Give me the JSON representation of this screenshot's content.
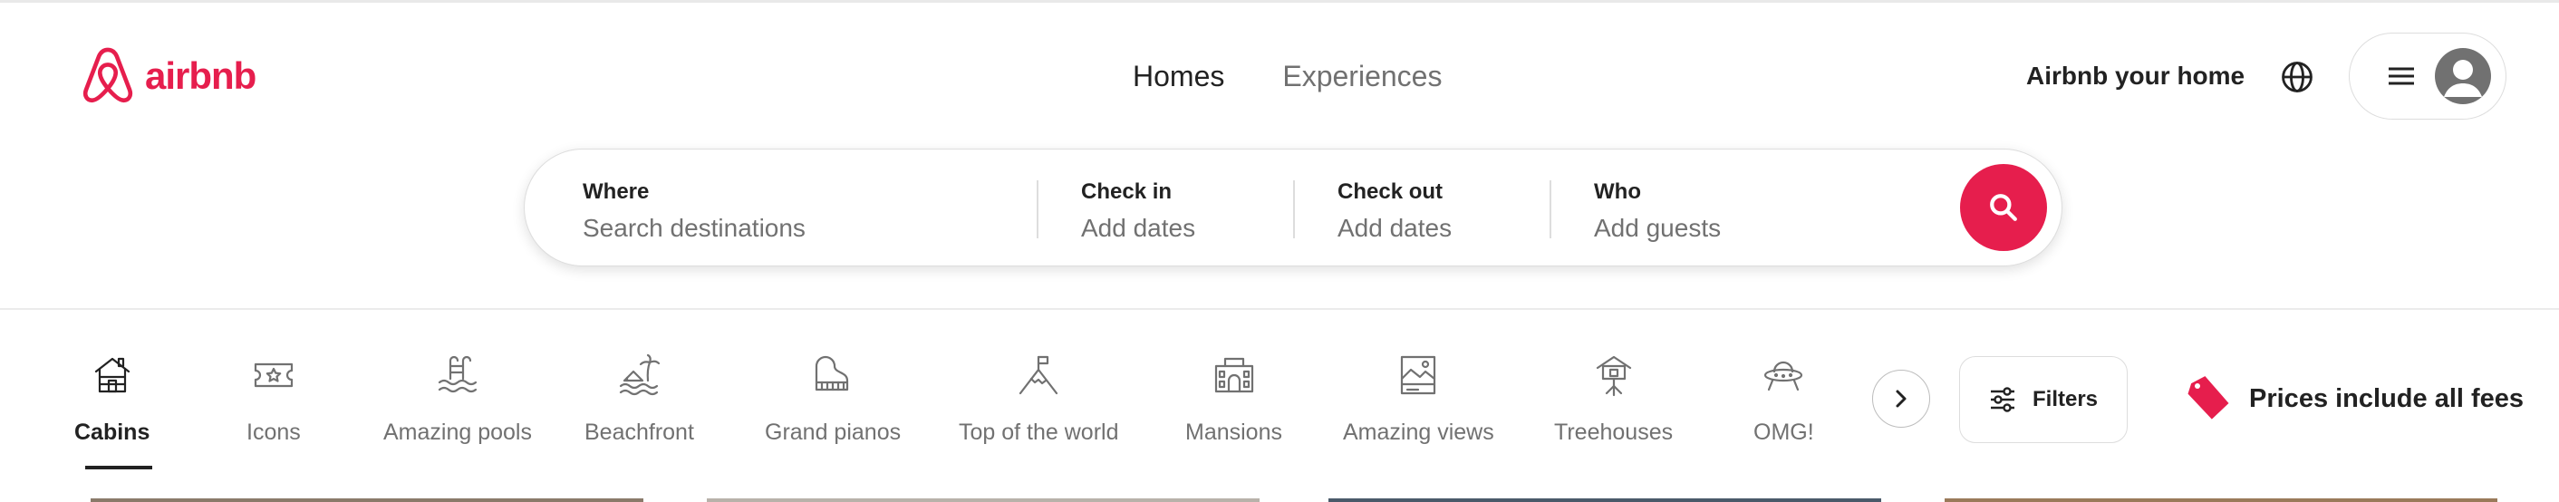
{
  "brand": {
    "name": "airbnb",
    "accent_color": "#e61e4d"
  },
  "nav": {
    "tabs": [
      {
        "label": "Homes",
        "active": true
      },
      {
        "label": "Experiences",
        "active": false
      }
    ],
    "host_link": "Airbnb your home",
    "globe_icon": "globe-icon",
    "menu_icon": "hamburger-icon",
    "avatar_icon": "user-avatar-icon"
  },
  "search": {
    "where": {
      "label": "Where",
      "placeholder": "Search destinations"
    },
    "checkin": {
      "label": "Check in",
      "placeholder": "Add dates"
    },
    "checkout": {
      "label": "Check out",
      "placeholder": "Add dates"
    },
    "who": {
      "label": "Who",
      "placeholder": "Add guests"
    },
    "button_icon": "search-icon"
  },
  "categories": [
    {
      "label": "Cabins",
      "icon": "cabin-icon",
      "active": true
    },
    {
      "label": "Icons",
      "icon": "ticket-star-icon",
      "active": false
    },
    {
      "label": "Amazing pools",
      "icon": "pool-icon",
      "active": false
    },
    {
      "label": "Beachfront",
      "icon": "beach-icon",
      "active": false
    },
    {
      "label": "Grand pianos",
      "icon": "piano-icon",
      "active": false
    },
    {
      "label": "Top of the world",
      "icon": "mountain-flag-icon",
      "active": false
    },
    {
      "label": "Mansions",
      "icon": "mansion-icon",
      "active": false
    },
    {
      "label": "Amazing views",
      "icon": "view-icon",
      "active": false
    },
    {
      "label": "Treehouses",
      "icon": "treehouse-icon",
      "active": false
    },
    {
      "label": "OMG!",
      "icon": "ufo-icon",
      "active": false
    }
  ],
  "filters": {
    "label": "Filters",
    "icon": "sliders-icon",
    "next_icon": "chevron-right-icon"
  },
  "fees": {
    "label": "Prices include all fees",
    "icon": "price-tag-icon"
  }
}
